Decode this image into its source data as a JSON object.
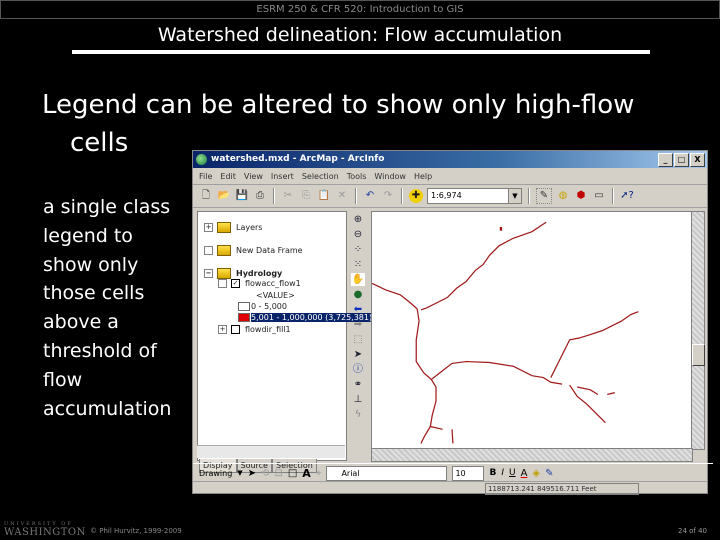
{
  "course_header": "ESRM 250 & CFR 520: Introduction to GIS",
  "slide_title": "Watershed delineation: Flow accumulation",
  "headline": [
    "Legend can be altered to show only high-flow",
    "cells"
  ],
  "side_text": [
    "a single class",
    "legend to",
    "show only",
    "those cells",
    "above a",
    "threshold of",
    "flow",
    "accumulation"
  ],
  "window": {
    "title": "watershed.mxd - ArcMap - ArcInfo",
    "controls": [
      "_",
      "□",
      "X"
    ],
    "menu": [
      "File",
      "Edit",
      "View",
      "Insert",
      "Selection",
      "Tools",
      "Window",
      "Help"
    ],
    "scale_value": "1:6,974",
    "toc": {
      "layers": "Layers",
      "new_data_frame": "New Data Frame",
      "hydrology": "Hydrology",
      "flowacc_layer": "flowacc_flow1",
      "value_header": "<VALUE>",
      "class_low": "0 - 5,000",
      "class_high": "5,001 - 1,000,000 (3,725,381)",
      "flowdir_layer": "flowdir_fill1",
      "tabs": [
        "Display",
        "Source",
        "Selection"
      ]
    },
    "drawing_label": "Drawing",
    "font_name": "Arial",
    "font_size": "10",
    "status_coords": "1188713.241 849516.711 Feet",
    "colors": {
      "accent_flow": "#a01818",
      "class_high": "#e00000",
      "selection": "#0a246a"
    }
  },
  "footer": {
    "university_small": "UNIVERSITY OF",
    "university_big": "WASHINGTON",
    "copyright": "© Phil Hurvitz, 1999-2009",
    "page": "24 of 40"
  }
}
